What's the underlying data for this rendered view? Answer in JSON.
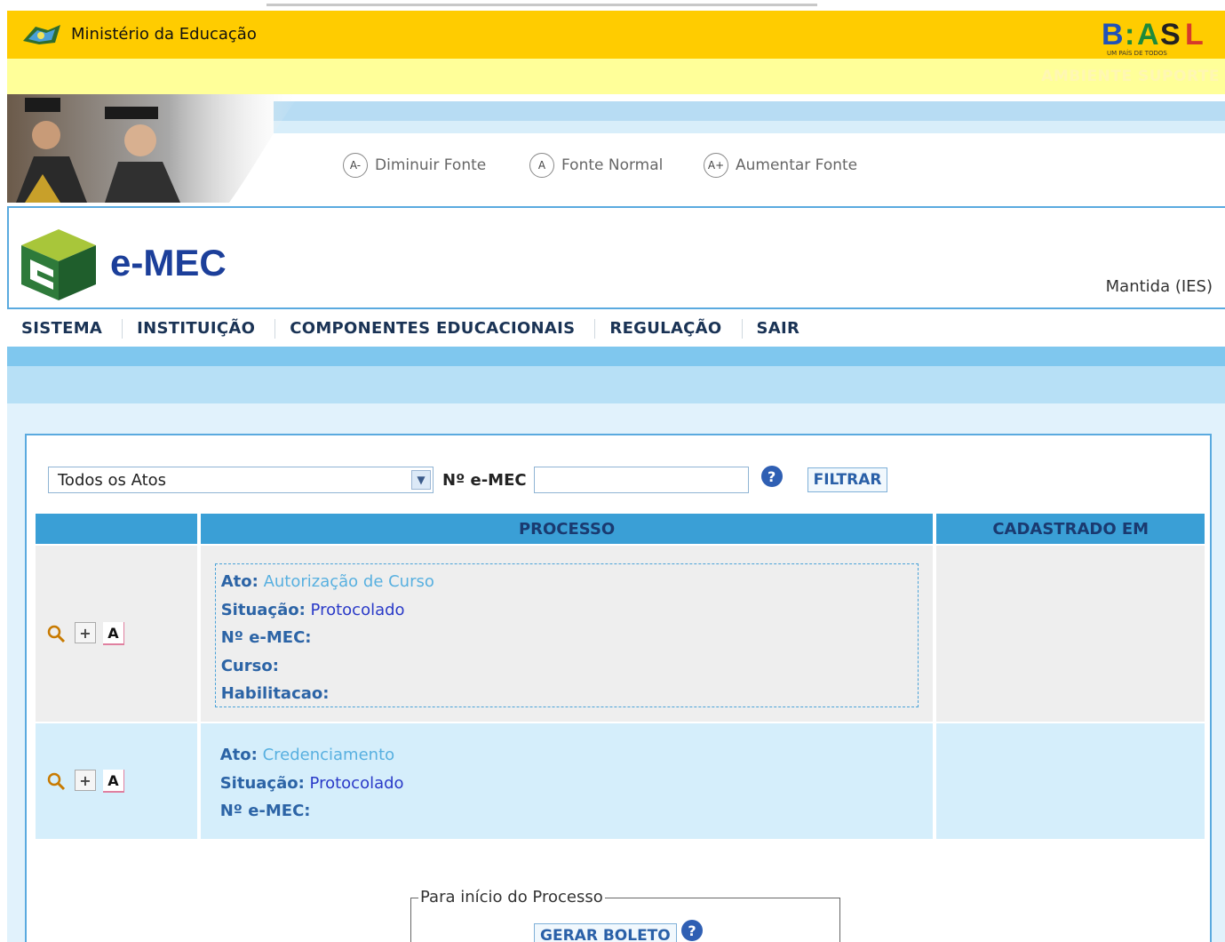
{
  "gov_bar": {
    "ministry": "Ministério da Educação",
    "brasil_logo": "B:ASL",
    "brasil_tagline": "UM PAÍS DE TODOS",
    "environment_label": "AMBIENTE SUPORTE"
  },
  "font_controls": [
    {
      "icon": "A-",
      "label": "Diminuir Fonte"
    },
    {
      "icon": "A",
      "label": "Fonte Normal"
    },
    {
      "icon": "A+",
      "label": "Aumentar Fonte"
    }
  ],
  "header": {
    "app_title": "e-MEC",
    "user": "Mantida (IES)"
  },
  "menu": [
    "SISTEMA",
    "INSTITUIÇÃO",
    "COMPONENTES EDUCACIONAIS",
    "REGULAÇÃO",
    "SAIR"
  ],
  "filter": {
    "select_value": "Todos os Atos",
    "number_label": "Nº e-MEC",
    "number_value": "",
    "help_icon": "?",
    "button": "FILTRAR"
  },
  "table": {
    "headers": [
      "",
      "PROCESSO",
      "CADASTRADO EM"
    ],
    "row_icons": {
      "view": "magnifier-icon",
      "add": "plus-icon",
      "ato": "A"
    },
    "rows": [
      {
        "ato_label": "Ato:",
        "ato": "Autorização de Curso",
        "situacao_label": "Situação:",
        "situacao": "Protocolado",
        "numero_label": "Nº e-MEC:",
        "curso_label": "Curso:",
        "habilitacao_label": "Habilitacao:",
        "cadastrado_em": ""
      },
      {
        "ato_label": "Ato:",
        "ato": "Credenciamento",
        "situacao_label": "Situação:",
        "situacao": "Protocolado",
        "numero_label": "Nº e-MEC:",
        "cadastrado_em": ""
      }
    ]
  },
  "process_start": {
    "legend": "Para início do Processo",
    "button": "GERAR BOLETO",
    "help_icon": "?"
  },
  "colors": {
    "gov_yellow": "#ffcc00",
    "support_yellow": "#ffff99",
    "header_blue": "#3a9fd6",
    "link_blue": "#2a3ac8"
  }
}
